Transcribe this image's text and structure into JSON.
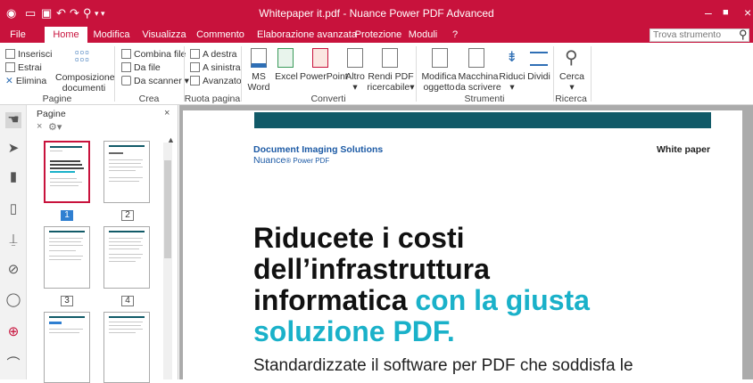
{
  "window": {
    "title": "Whitepaper it.pdf - Nuance Power PDF Advanced"
  },
  "tabs": [
    {
      "label": "File"
    },
    {
      "label": "Home"
    },
    {
      "label": "Modifica"
    },
    {
      "label": "Visualizza"
    },
    {
      "label": "Commento"
    },
    {
      "label": "Elaborazione avanzata"
    },
    {
      "label": "Protezione"
    },
    {
      "label": "Moduli"
    },
    {
      "label": "?"
    }
  ],
  "search": {
    "placeholder": "Trova strumento"
  },
  "ribbon": {
    "pagine": {
      "label": "Pagine",
      "inserisci": "Inserisci",
      "estrai": "Estrai",
      "elimina": "Elimina",
      "composizione1": "Composizione",
      "composizione2": "documenti"
    },
    "crea": {
      "label": "Crea",
      "combina": "Combina file",
      "da_file": "Da file",
      "da_scanner": "Da scanner"
    },
    "ruota": {
      "label": "Ruota pagina",
      "destra": "A destra",
      "sinistra": "A sinistra",
      "avanzato": "Avanzato"
    },
    "converti": {
      "label": "Converti",
      "ms1": "MS",
      "ms2": "Word",
      "excel": "Excel",
      "powerpoint": "PowerPoint",
      "altro": "Altro",
      "rendi1": "Rendi PDF",
      "rendi2": "ricercabile"
    },
    "strumenti": {
      "label": "Strumenti",
      "modifica1": "Modifica",
      "modifica2": "oggetto",
      "macchina1": "Macchina",
      "macchina2": "da scrivere",
      "riduci": "Riduci",
      "dividi": "Dividi"
    },
    "ricerca": {
      "label": "Ricerca",
      "cerca": "Cerca"
    }
  },
  "panel": {
    "title": "Pagine",
    "pages": [
      {
        "num": "1"
      },
      {
        "num": "2"
      },
      {
        "num": "3"
      },
      {
        "num": "4"
      }
    ],
    "thumb1_lines": [
      "Ridurre i costi",
      "dell'infrastruttura",
      "informatica con la giusta",
      "soluzione PDF."
    ],
    "thumb2_title": "Sommario"
  },
  "document": {
    "brand_line1": "Document Imaging Solutions",
    "brand_line2_a": "Nuance",
    "brand_line2_b": "® Power PDF",
    "doc_type": "White paper",
    "headline_line1": "Riducete i costi",
    "headline_line2": "dell’infrastruttura",
    "headline_line3_dark": "informatica ",
    "headline_line3_teal": "con la giusta",
    "headline_line4": "soluzione PDF.",
    "subtitle": "Standardizzate il software per PDF che soddisfa le"
  },
  "colors": {
    "brand_red": "#c8123c",
    "doc_teal": "#115a68",
    "headline_accent": "#1ab1c9",
    "brand_blue": "#1c5aa5"
  }
}
